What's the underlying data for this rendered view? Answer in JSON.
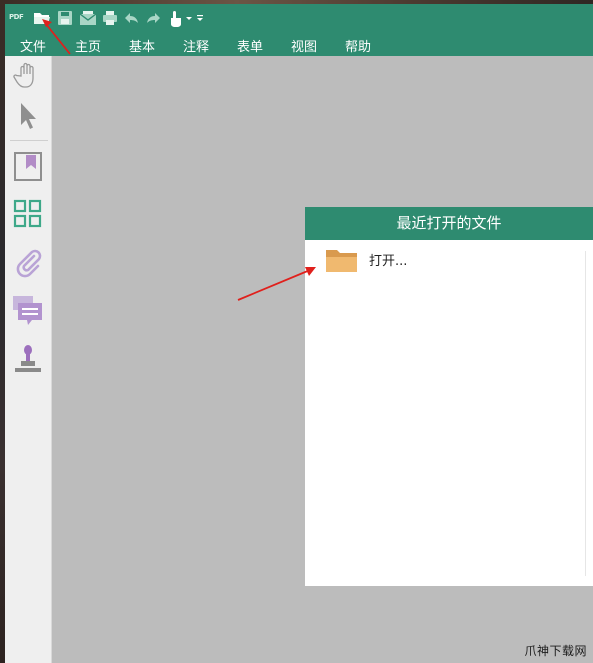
{
  "app": {
    "logo_text": "PDF"
  },
  "quick_access": {
    "icons": [
      "open-folder-icon",
      "save-icon",
      "email-icon",
      "print-icon",
      "undo-icon",
      "redo-icon",
      "hand-pointer-icon",
      "customize-icon"
    ]
  },
  "menu": {
    "items": [
      "文件",
      "主页",
      "基本",
      "注释",
      "表单",
      "视图",
      "帮助"
    ]
  },
  "rail": {
    "icons": [
      "hand-tool-icon",
      "select-arrow-icon",
      "bookmark-icon",
      "thumbnails-icon",
      "attachment-icon",
      "comments-icon",
      "stamp-icon"
    ]
  },
  "recent": {
    "title": "最近打开的文件",
    "open_label": "打开..."
  },
  "colors": {
    "accent": "#2e8b70",
    "workspace": "#bcbcbc",
    "annotation_arrow": "#e0201c",
    "folder": "#e9ae62"
  },
  "watermark": "爪神下载网"
}
